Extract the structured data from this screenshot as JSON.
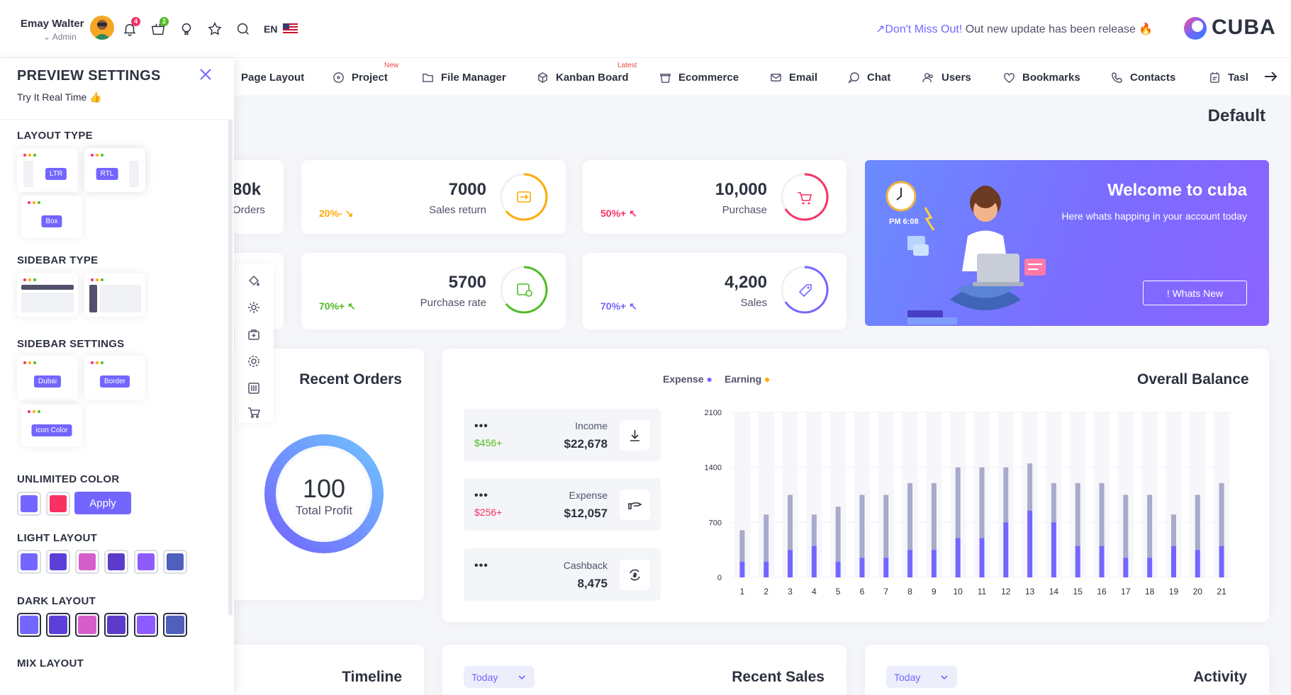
{
  "user": {
    "name": "Emay Walter",
    "role": "Admin"
  },
  "header": {
    "notifications_count": "4",
    "cart_count": "2",
    "language": "EN",
    "notice_highlight": "↗Don't Miss Out!",
    "notice_text": " Out new update has been release ",
    "brand": "CUBA"
  },
  "nav": {
    "items": [
      {
        "label": "Page Layout"
      },
      {
        "label": "Project",
        "badge": "New"
      },
      {
        "label": "File Manager"
      },
      {
        "label": "Kanban Board",
        "badge": "Latest"
      },
      {
        "label": "Ecommerce"
      },
      {
        "label": "Email"
      },
      {
        "label": "Chat"
      },
      {
        "label": "Users"
      },
      {
        "label": "Bookmarks"
      },
      {
        "label": "Contacts"
      },
      {
        "label": "Task"
      }
    ]
  },
  "page_title": "Default",
  "settings": {
    "title": "PREVIEW SETTINGS",
    "subtitle": "Try It Real Time",
    "layout_type": {
      "heading": "LAYOUT TYPE",
      "options": [
        "LTR",
        "RTL",
        "Box"
      ]
    },
    "sidebar_type": {
      "heading": "SIDEBAR TYPE"
    },
    "sidebar_settings": {
      "heading": "SIDEBAR SETTINGS",
      "options": [
        "Dubai",
        "Border",
        "icon Color"
      ]
    },
    "unlimited_color": {
      "heading": "UNLIMITED COLOR",
      "colors": [
        "#7366ff",
        "#f73164"
      ],
      "apply_label": "Apply"
    },
    "light_layout": {
      "heading": "LIGHT LAYOUT",
      "colors": [
        "#7366ff",
        "#5c3fd8",
        "#d65ecb",
        "#5b3bc9",
        "#8e5bff",
        "#4f5fbc"
      ]
    },
    "dark_layout": {
      "heading": "DARK LAYOUT",
      "colors": [
        "#7366ff",
        "#5c3fd8",
        "#d65ecb",
        "#5b3bc9",
        "#8e5bff",
        "#4f5fbc"
      ]
    },
    "mix_layout": {
      "heading": "MIX LAYOUT"
    }
  },
  "stats": {
    "partial": {
      "value": "80k",
      "label": "Orders"
    },
    "sales_return": {
      "value": "7000",
      "label": "Sales return",
      "change": "20%- ↘",
      "color": "#ffaa05"
    },
    "purchase": {
      "value": "10,000",
      "label": "Purchase",
      "change": "50%+ ↖",
      "color": "#f73164"
    },
    "purchase_rate": {
      "value": "5700",
      "label": "Purchase rate",
      "change": "70%+ ↖",
      "color": "#51bb25"
    },
    "sales": {
      "value": "4,200",
      "label": "Sales",
      "change": "70%+ ↖",
      "color": "#7366ff"
    }
  },
  "welcome": {
    "title": "Welcome to cuba",
    "subtitle": "Here whats happing in your account today",
    "button": "! Whats New",
    "time": "PM 6:08"
  },
  "recent_orders": {
    "title": "Recent Orders",
    "value": "100",
    "label": "Total Profit"
  },
  "overall_balance": {
    "title": "Overall Balance",
    "legend_expense": "Expense",
    "legend_earning": "Earning",
    "tiles": [
      {
        "label": "Income",
        "value": "$22,678",
        "change": "$456+",
        "change_color": "#51bb25"
      },
      {
        "label": "Expense",
        "value": "$12,057",
        "change": "$256+",
        "change_color": "#f73164"
      },
      {
        "label": "Cashback",
        "value": "8,475",
        "change": ""
      }
    ]
  },
  "chart_data": {
    "type": "bar",
    "categories": [
      "1",
      "2",
      "3",
      "4",
      "5",
      "6",
      "7",
      "8",
      "9",
      "10",
      "11",
      "12",
      "13",
      "14",
      "15",
      "16",
      "17",
      "18",
      "19",
      "20",
      "21"
    ],
    "series": [
      {
        "name": "Expense",
        "values": [
          200,
          200,
          350,
          400,
          200,
          250,
          250,
          350,
          350,
          500,
          500,
          700,
          850,
          700,
          400,
          400,
          250,
          250,
          400,
          350,
          400
        ]
      },
      {
        "name": "Earning",
        "values": [
          400,
          600,
          700,
          400,
          700,
          800,
          800,
          850,
          850,
          900,
          900,
          700,
          600,
          500,
          800,
          800,
          800,
          800,
          400,
          700,
          800
        ]
      }
    ],
    "ylim": [
      0,
      2100
    ],
    "yticks": [
      0,
      700,
      1400,
      2100
    ],
    "stacked": true,
    "colors": [
      "#7366ff",
      "#a8abca"
    ]
  },
  "bottom": {
    "timeline_title": "Timeline",
    "recent_sales_title": "Recent Sales",
    "activity_title": "Activity",
    "dropdown_value": "Today"
  }
}
